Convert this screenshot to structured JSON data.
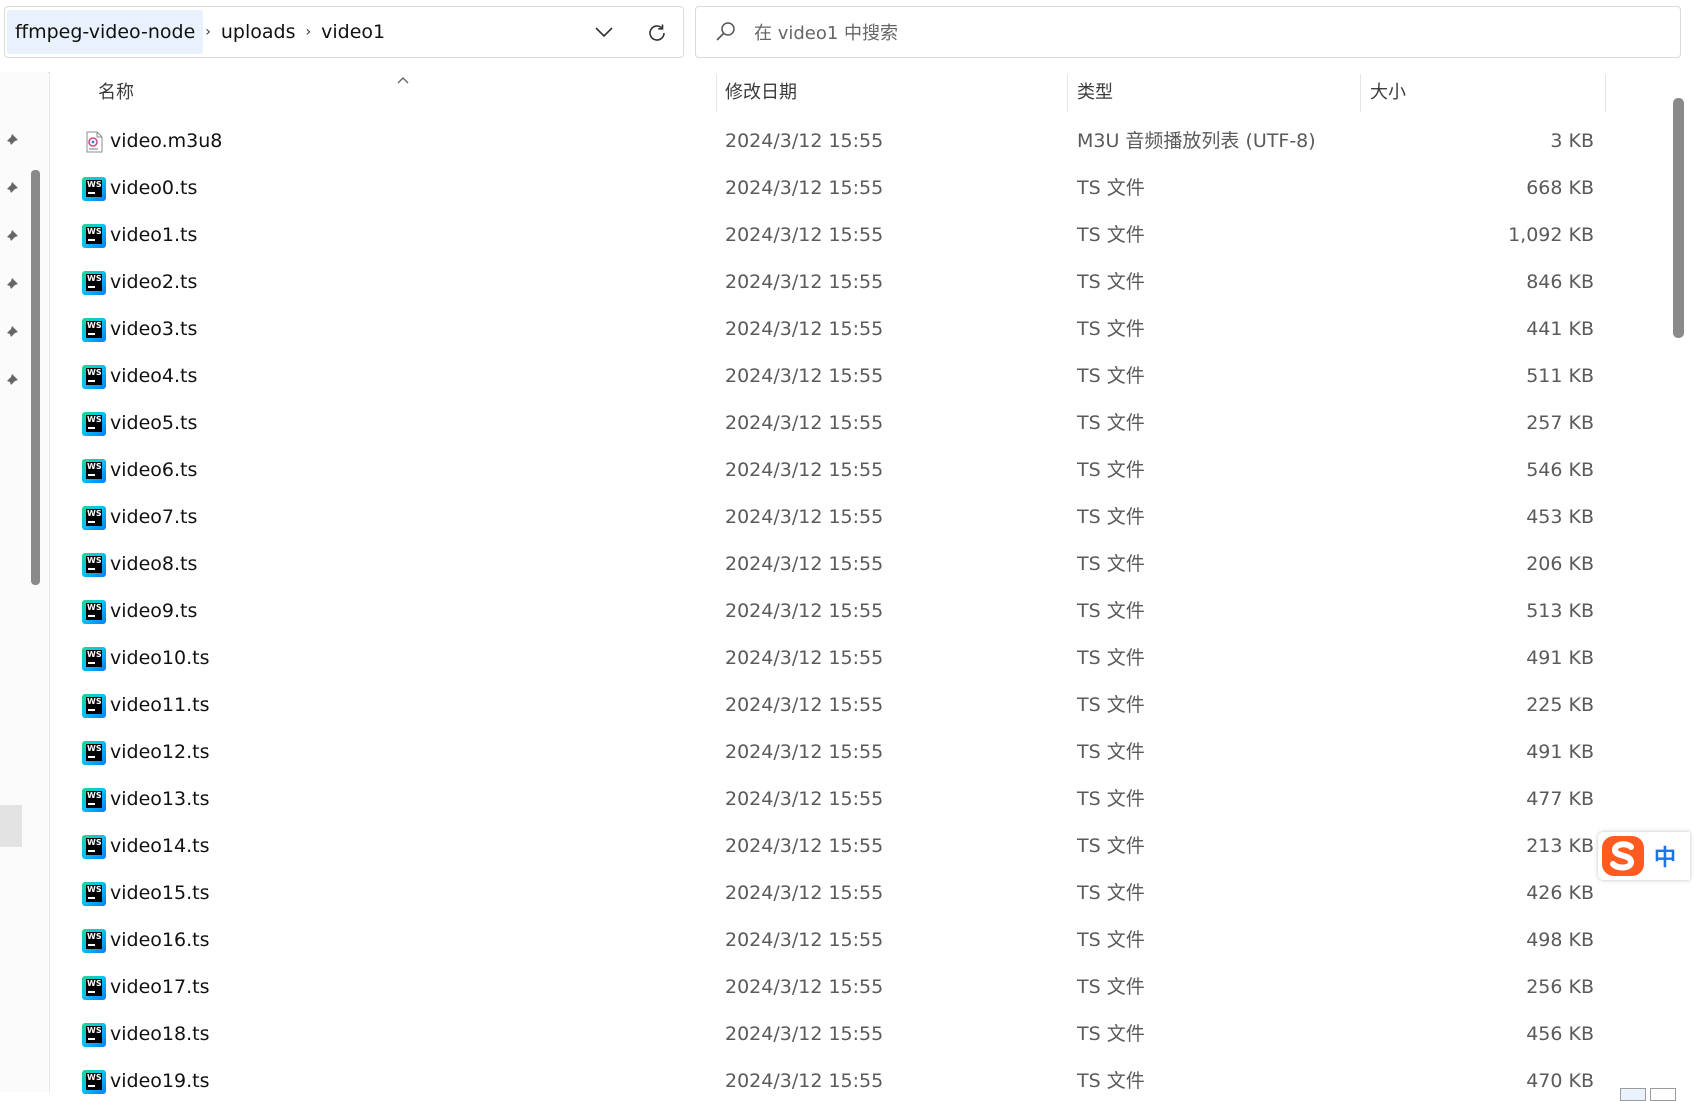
{
  "address": {
    "crumbs": [
      "ffmpeg-video-node",
      "uploads",
      "video1"
    ]
  },
  "search": {
    "placeholder": "在 video1 中搜索"
  },
  "columns": {
    "name": "名称",
    "date": "修改日期",
    "type": "类型",
    "size": "大小"
  },
  "files": [
    {
      "name": "video.m3u8",
      "date": "2024/3/12 15:55",
      "type": "M3U 音频播放列表 (UTF-8)",
      "size": "3 KB",
      "icon": "m3u8-file-icon"
    },
    {
      "name": "video0.ts",
      "date": "2024/3/12 15:55",
      "type": "TS 文件",
      "size": "668 KB",
      "icon": "webstorm-file-icon"
    },
    {
      "name": "video1.ts",
      "date": "2024/3/12 15:55",
      "type": "TS 文件",
      "size": "1,092 KB",
      "icon": "webstorm-file-icon"
    },
    {
      "name": "video2.ts",
      "date": "2024/3/12 15:55",
      "type": "TS 文件",
      "size": "846 KB",
      "icon": "webstorm-file-icon"
    },
    {
      "name": "video3.ts",
      "date": "2024/3/12 15:55",
      "type": "TS 文件",
      "size": "441 KB",
      "icon": "webstorm-file-icon"
    },
    {
      "name": "video4.ts",
      "date": "2024/3/12 15:55",
      "type": "TS 文件",
      "size": "511 KB",
      "icon": "webstorm-file-icon"
    },
    {
      "name": "video5.ts",
      "date": "2024/3/12 15:55",
      "type": "TS 文件",
      "size": "257 KB",
      "icon": "webstorm-file-icon"
    },
    {
      "name": "video6.ts",
      "date": "2024/3/12 15:55",
      "type": "TS 文件",
      "size": "546 KB",
      "icon": "webstorm-file-icon"
    },
    {
      "name": "video7.ts",
      "date": "2024/3/12 15:55",
      "type": "TS 文件",
      "size": "453 KB",
      "icon": "webstorm-file-icon"
    },
    {
      "name": "video8.ts",
      "date": "2024/3/12 15:55",
      "type": "TS 文件",
      "size": "206 KB",
      "icon": "webstorm-file-icon"
    },
    {
      "name": "video9.ts",
      "date": "2024/3/12 15:55",
      "type": "TS 文件",
      "size": "513 KB",
      "icon": "webstorm-file-icon"
    },
    {
      "name": "video10.ts",
      "date": "2024/3/12 15:55",
      "type": "TS 文件",
      "size": "491 KB",
      "icon": "webstorm-file-icon"
    },
    {
      "name": "video11.ts",
      "date": "2024/3/12 15:55",
      "type": "TS 文件",
      "size": "225 KB",
      "icon": "webstorm-file-icon"
    },
    {
      "name": "video12.ts",
      "date": "2024/3/12 15:55",
      "type": "TS 文件",
      "size": "491 KB",
      "icon": "webstorm-file-icon"
    },
    {
      "name": "video13.ts",
      "date": "2024/3/12 15:55",
      "type": "TS 文件",
      "size": "477 KB",
      "icon": "webstorm-file-icon"
    },
    {
      "name": "video14.ts",
      "date": "2024/3/12 15:55",
      "type": "TS 文件",
      "size": "213 KB",
      "icon": "webstorm-file-icon"
    },
    {
      "name": "video15.ts",
      "date": "2024/3/12 15:55",
      "type": "TS 文件",
      "size": "426 KB",
      "icon": "webstorm-file-icon"
    },
    {
      "name": "video16.ts",
      "date": "2024/3/12 15:55",
      "type": "TS 文件",
      "size": "498 KB",
      "icon": "webstorm-file-icon"
    },
    {
      "name": "video17.ts",
      "date": "2024/3/12 15:55",
      "type": "TS 文件",
      "size": "256 KB",
      "icon": "webstorm-file-icon"
    },
    {
      "name": "video18.ts",
      "date": "2024/3/12 15:55",
      "type": "TS 文件",
      "size": "456 KB",
      "icon": "webstorm-file-icon"
    },
    {
      "name": "video19.ts",
      "date": "2024/3/12 15:55",
      "type": "TS 文件",
      "size": "470 KB",
      "icon": "webstorm-file-icon"
    }
  ],
  "ime": {
    "language": "中",
    "brand_color": "#ff5a1f",
    "lang_color": "#1e73e8"
  },
  "nav": {
    "pins": [
      "pin-icon",
      "pin-icon",
      "pin-icon",
      "pin-icon",
      "pin-icon",
      "pin-icon"
    ]
  }
}
